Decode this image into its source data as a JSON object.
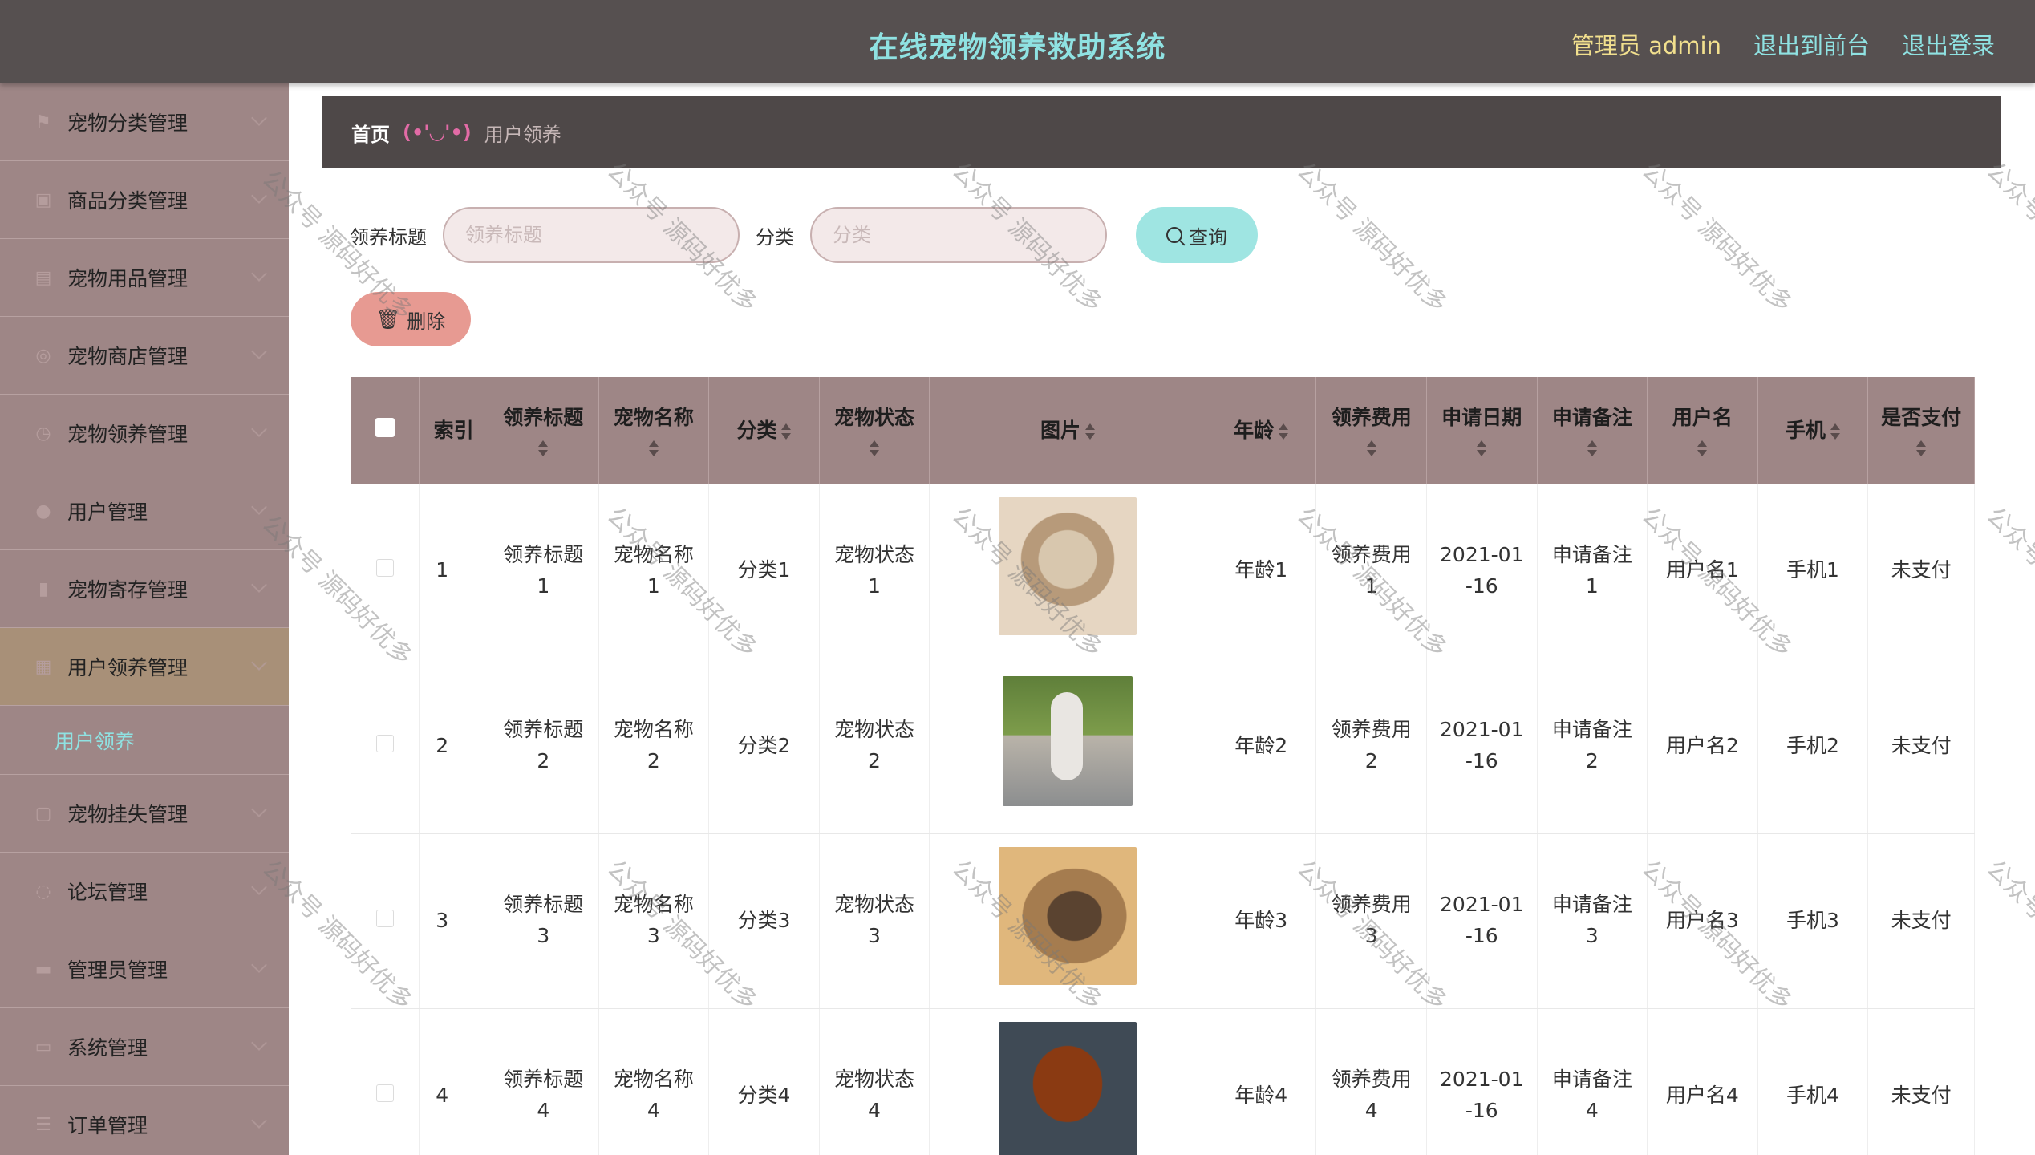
{
  "header": {
    "title": "在线宠物领养救助系统",
    "admin_label": "管理员 admin",
    "to_front_label": "退出到前台",
    "logout_label": "退出登录"
  },
  "sidebar": {
    "items": [
      {
        "label": "宠物分类管理",
        "icon": "flag-icon"
      },
      {
        "label": "商品分类管理",
        "icon": "briefcase-icon"
      },
      {
        "label": "宠物用品管理",
        "icon": "box-icon"
      },
      {
        "label": "宠物商店管理",
        "icon": "shop-icon"
      },
      {
        "label": "宠物领养管理",
        "icon": "clock-icon"
      },
      {
        "label": "用户管理",
        "icon": "user-icon"
      },
      {
        "label": "宠物寄存管理",
        "icon": "bar-chart-icon"
      },
      {
        "label": "用户领养管理",
        "icon": "grid-icon"
      },
      {
        "label": "宠物挂失管理",
        "icon": "frame-icon"
      },
      {
        "label": "论坛管理",
        "icon": "comment-icon"
      },
      {
        "label": "管理员管理",
        "icon": "monitor-icon"
      },
      {
        "label": "系统管理",
        "icon": "message-icon"
      },
      {
        "label": "订单管理",
        "icon": "list-icon"
      }
    ],
    "open_submenu": {
      "label": "用户领养"
    }
  },
  "breadcrumb": {
    "home": "首页",
    "separator": "(•'◡'•)",
    "current": "用户领养"
  },
  "search": {
    "title_label": "领养标题",
    "title_placeholder": "领养标题",
    "category_label": "分类",
    "category_placeholder": "分类",
    "query_label": "查询"
  },
  "actions": {
    "delete_label": "删除"
  },
  "table": {
    "columns": [
      "索引",
      "领养标题",
      "宠物名称",
      "分类",
      "宠物状态",
      "图片",
      "年龄",
      "领养费用",
      "申请日期",
      "申请备注",
      "用户名",
      "手机",
      "是否支付"
    ],
    "rows": [
      {
        "index": "1",
        "title": "领养标题\n1",
        "pet_name": "宠物名称\n1",
        "category": "分类1",
        "status": "宠物状态\n1",
        "age": "年龄1",
        "fee": "领养费用\n1",
        "date": "2021-01\n-16",
        "remark": "申请备注\n1",
        "username": "用户名1",
        "phone": "手机1",
        "paid": "未支付"
      },
      {
        "index": "2",
        "title": "领养标题\n2",
        "pet_name": "宠物名称\n2",
        "category": "分类2",
        "status": "宠物状态\n2",
        "age": "年龄2",
        "fee": "领养费用\n2",
        "date": "2021-01\n-16",
        "remark": "申请备注\n2",
        "username": "用户名2",
        "phone": "手机2",
        "paid": "未支付"
      },
      {
        "index": "3",
        "title": "领养标题\n3",
        "pet_name": "宠物名称\n3",
        "category": "分类3",
        "status": "宠物状态\n3",
        "age": "年龄3",
        "fee": "领养费用\n3",
        "date": "2021-01\n-16",
        "remark": "申请备注\n3",
        "username": "用户名3",
        "phone": "手机3",
        "paid": "未支付"
      },
      {
        "index": "4",
        "title": "领养标题\n4",
        "pet_name": "宠物名称\n4",
        "category": "分类4",
        "status": "宠物状态\n4",
        "age": "年龄4",
        "fee": "领养费用\n4",
        "date": "2021-01\n-16",
        "remark": "申请备注\n4",
        "username": "用户名4",
        "phone": "手机4",
        "paid": "未支付"
      }
    ]
  },
  "watermark": {
    "text": "公众号 源码好优多"
  },
  "colors": {
    "topbar": "#565050",
    "sidebar": "#9e8686",
    "accent_cyan": "#8fe2e2",
    "query_button": "#9fe5e2",
    "delete_button": "#e79a92",
    "admin_text": "#f2e08e"
  }
}
